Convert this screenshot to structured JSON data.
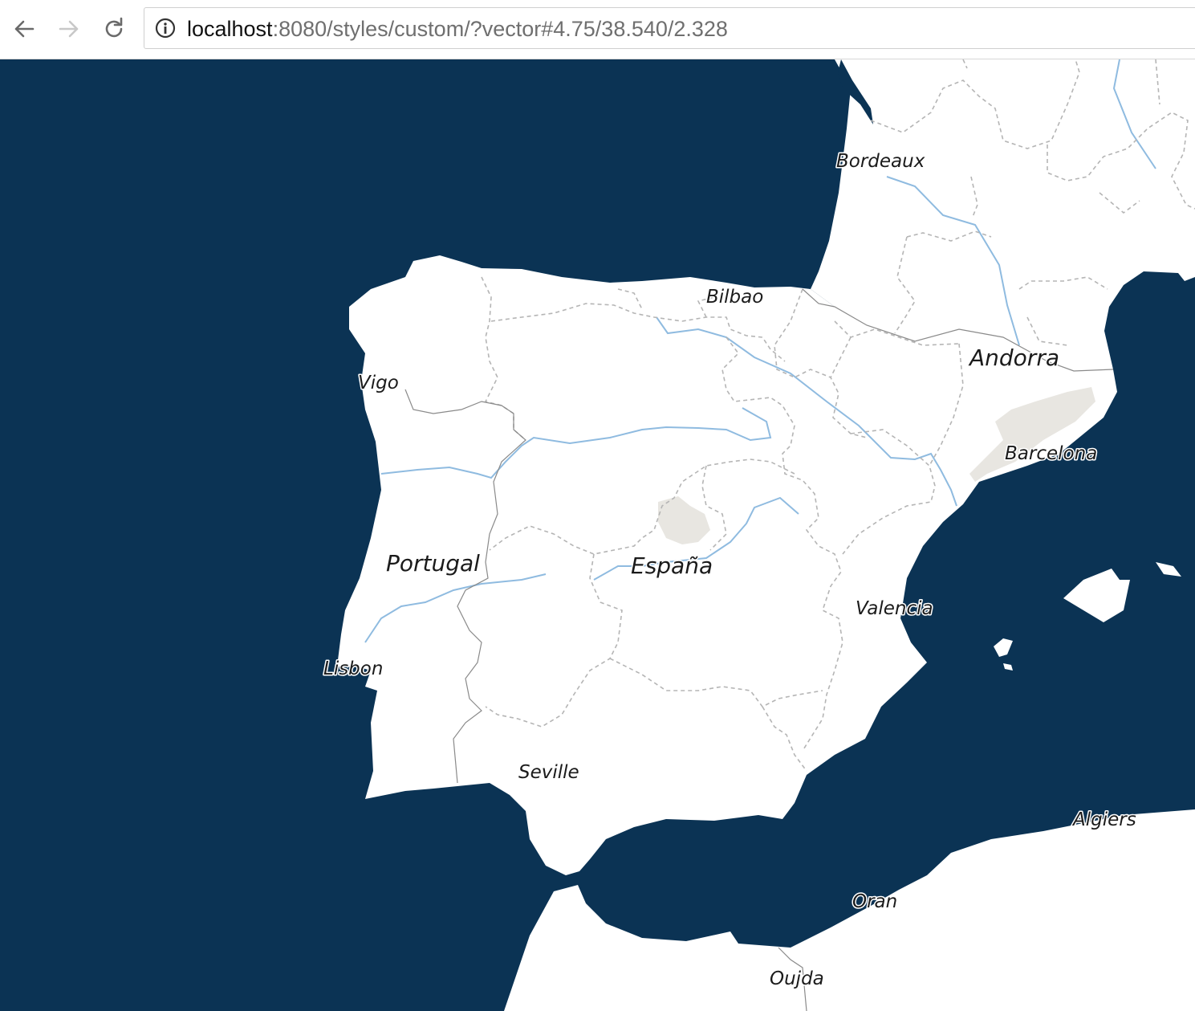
{
  "browser": {
    "nav": {
      "back": "back-arrow-icon",
      "forward": "forward-arrow-icon",
      "reload": "reload-icon",
      "site_info": "info-icon"
    },
    "url_host": "localhost",
    "url_rest": ":8080/styles/custom/?vector#4.75/38.540/2.328"
  },
  "map": {
    "colors": {
      "water": "#0b3354",
      "land": "#ffffff",
      "river": "#8fbbe0",
      "border": "#b5b5b5",
      "urban": "#e8e6e1"
    },
    "labels": {
      "bordeaux": "Bordeaux",
      "bilbao": "Bilbao",
      "andorra": "Andorra",
      "vigo": "Vigo",
      "barcelona": "Barcelona",
      "portugal": "Portugal",
      "espana": "España",
      "valencia": "Valencia",
      "lisbon": "Lisbon",
      "seville": "Seville",
      "algiers": "Algiers",
      "oran": "Oran",
      "oujda": "Oujda"
    }
  }
}
